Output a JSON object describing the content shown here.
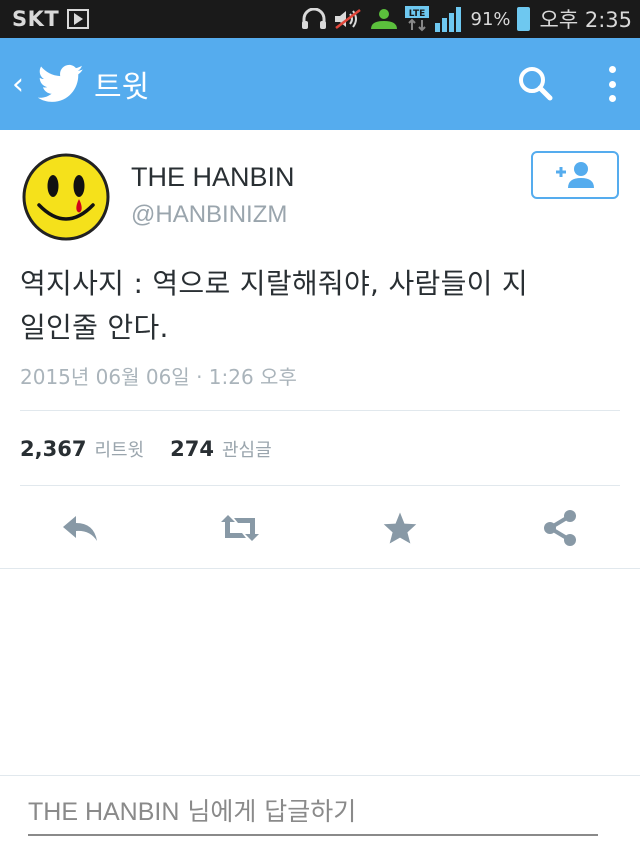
{
  "status_bar": {
    "carrier": "SKT",
    "network": "LTE",
    "battery_percent": "91%",
    "time": "오후 2:35",
    "icons": [
      "play-icon",
      "headset-icon",
      "mute-icon",
      "phone-call-icon",
      "lte-icon",
      "signal-icon",
      "battery-icon"
    ]
  },
  "toolbar": {
    "back_glyph": "‹",
    "title": "트윗",
    "icons": [
      "twitter-bird-icon",
      "search-icon",
      "overflow-menu-icon"
    ],
    "background": "#55acee"
  },
  "tweet": {
    "display_name": "THE HANBIN",
    "handle": "@HANBINIZM",
    "text_line1": "역지사지 : 역으로 지랄해줘야, 사람들이 지",
    "text_line2": "일인줄 안다.",
    "timestamp": "2015년 06월 06일 · 1:26 오후"
  },
  "stats": {
    "retweets_count": "2,367",
    "retweets_label": "리트윗",
    "favorites_count": "274",
    "favorites_label": "관심글"
  },
  "actions": [
    "reply-icon",
    "retweet-icon",
    "favorite-icon",
    "share-icon"
  ],
  "reply": {
    "name": "THE HANBIN",
    "suffix": " 님에게 답글하기"
  },
  "colors": {
    "accent": "#55acee",
    "action_icon": "#8899a6",
    "avatar_yellow": "#f5e11b",
    "tear_red": "#d0021b"
  }
}
